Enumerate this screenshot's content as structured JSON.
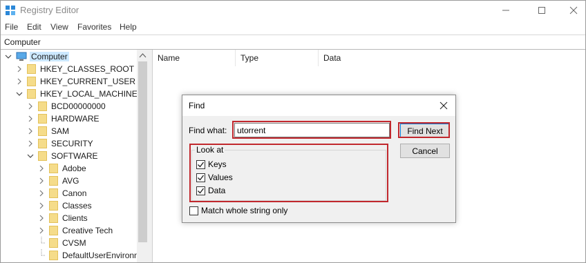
{
  "window": {
    "title": "Registry Editor",
    "address": "Computer"
  },
  "menu": {
    "items": [
      "File",
      "Edit",
      "View",
      "Favorites",
      "Help"
    ]
  },
  "tree": {
    "root": "Computer",
    "items": [
      {
        "label": "HKEY_CLASSES_ROOT",
        "level": 1,
        "state": "collapsed"
      },
      {
        "label": "HKEY_CURRENT_USER",
        "level": 1,
        "state": "collapsed"
      },
      {
        "label": "HKEY_LOCAL_MACHINE",
        "level": 1,
        "state": "expanded"
      },
      {
        "label": "BCD00000000",
        "level": 2,
        "state": "collapsed"
      },
      {
        "label": "HARDWARE",
        "level": 2,
        "state": "collapsed"
      },
      {
        "label": "SAM",
        "level": 2,
        "state": "collapsed"
      },
      {
        "label": "SECURITY",
        "level": 2,
        "state": "collapsed"
      },
      {
        "label": "SOFTWARE",
        "level": 2,
        "state": "expanded"
      },
      {
        "label": "Adobe",
        "level": 3,
        "state": "collapsed"
      },
      {
        "label": "AVG",
        "level": 3,
        "state": "collapsed"
      },
      {
        "label": "Canon",
        "level": 3,
        "state": "collapsed"
      },
      {
        "label": "Classes",
        "level": 3,
        "state": "collapsed"
      },
      {
        "label": "Clients",
        "level": 3,
        "state": "collapsed"
      },
      {
        "label": "Creative Tech",
        "level": 3,
        "state": "collapsed"
      },
      {
        "label": "CVSM",
        "level": 3,
        "state": "leaf"
      },
      {
        "label": "DefaultUserEnvironn",
        "level": 3,
        "state": "leaf"
      }
    ]
  },
  "list": {
    "columns": [
      "Name",
      "Type",
      "Data"
    ]
  },
  "find_dialog": {
    "title": "Find",
    "find_what_label": "Find what:",
    "find_what_value": "utorrent",
    "find_next_label": "Find Next",
    "cancel_label": "Cancel",
    "look_at_label": "Look at",
    "options": [
      {
        "label": "Keys",
        "checked": true
      },
      {
        "label": "Values",
        "checked": true
      },
      {
        "label": "Data",
        "checked": true
      }
    ],
    "match_whole_label": "Match whole string only",
    "match_whole_checked": false
  },
  "colors": {
    "highlight": "#c1272d",
    "selection": "#cce8ff",
    "folder": "#f5dc8a"
  }
}
